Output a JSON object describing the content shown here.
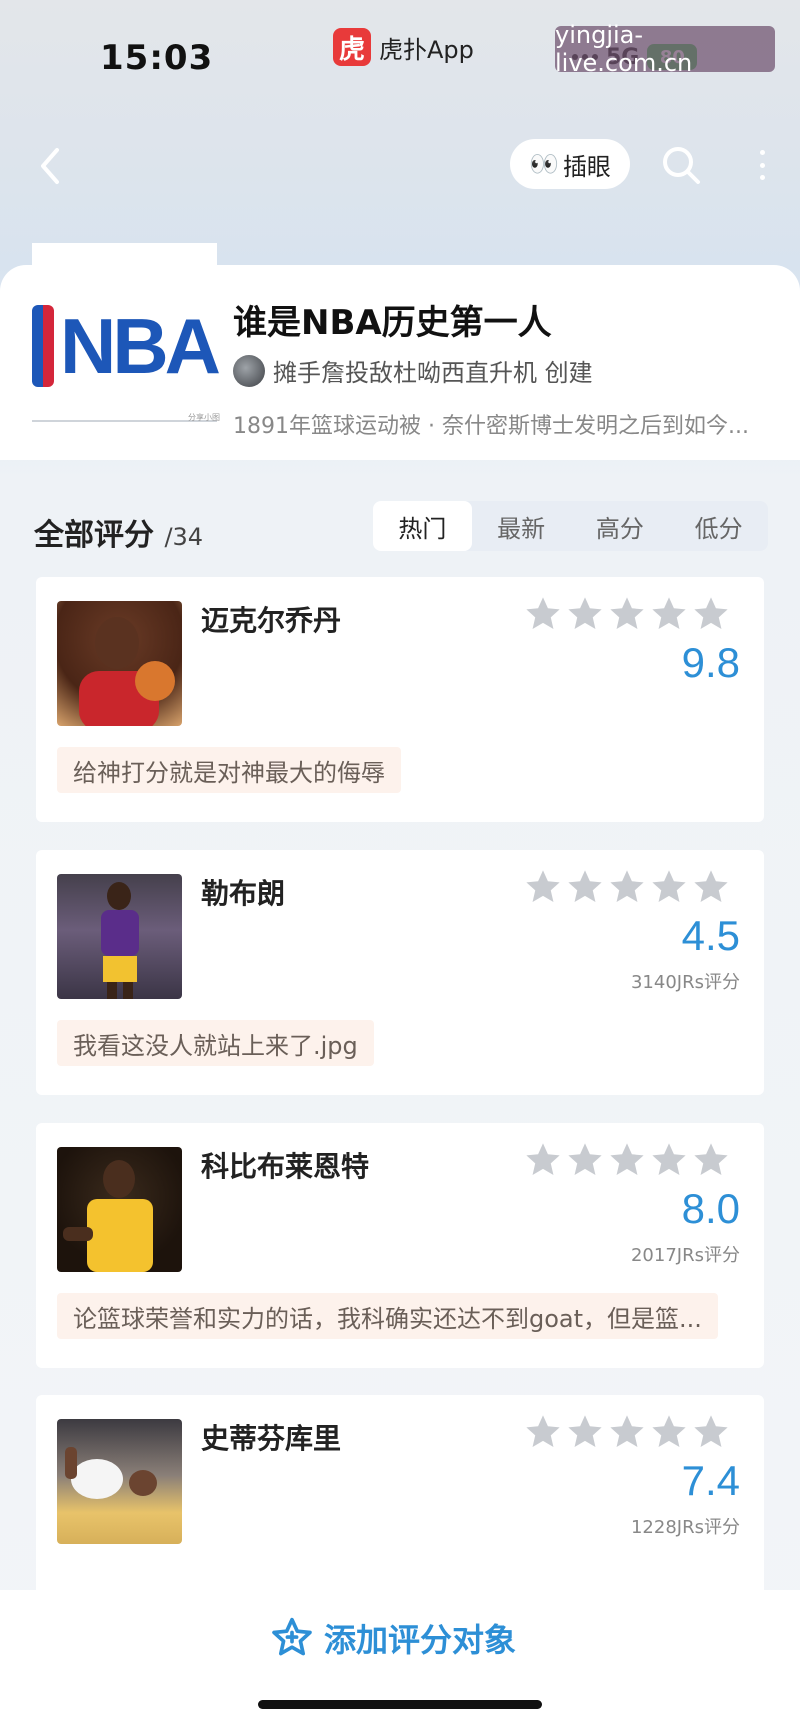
{
  "status_bar": {
    "time": "15:03",
    "app_icon_glyph": "虎",
    "app_name": "虎扑App",
    "network": "5G",
    "battery": "80",
    "watermark": "yingjia-live.com.cn"
  },
  "nav": {
    "back_icon": "chevron-left-icon",
    "eye_label": "插眼",
    "eye_emoji": "👀",
    "search_icon": "search-icon",
    "more_icon": "more-vertical-icon"
  },
  "topic": {
    "logo_text": "NBA",
    "logo_caption": "分享小图",
    "title": "谁是NBA历史第一人",
    "creator": "摊手詹投敌杜呦西直升机 创建",
    "description": "1891年篮球运动被 · 奈什密斯博士发明之后到如今..."
  },
  "list": {
    "title": "全部评分",
    "count": "/34",
    "sort_tabs": [
      "热门",
      "最新",
      "高分",
      "低分"
    ],
    "active_tab": 0
  },
  "items": [
    {
      "name": "迈克尔乔丹",
      "score": "9.8",
      "rating_count": "",
      "comment": "给神打分就是对神最大的侮辱",
      "stars": 5
    },
    {
      "name": "勒布朗",
      "score": "4.5",
      "rating_count": "3140JRs评分",
      "comment": "我看这没人就站上来了.jpg",
      "stars": 5
    },
    {
      "name": "科比布莱恩特",
      "score": "8.0",
      "rating_count": "2017JRs评分",
      "comment": "论篮球荣誉和实力的话，我科确实还达不到goat，但是篮...",
      "stars": 5
    },
    {
      "name": "史蒂芬库里",
      "score": "7.4",
      "rating_count": "1228JRs评分",
      "comment": "",
      "stars": 5
    }
  ],
  "bottom": {
    "add_label": "添加评分对象",
    "add_icon": "star-plus-icon"
  },
  "colors": {
    "accent": "#2d8fd6",
    "brand_red": "#e83a3a",
    "nba_blue": "#1d57b8",
    "nba_red": "#d4263a"
  }
}
